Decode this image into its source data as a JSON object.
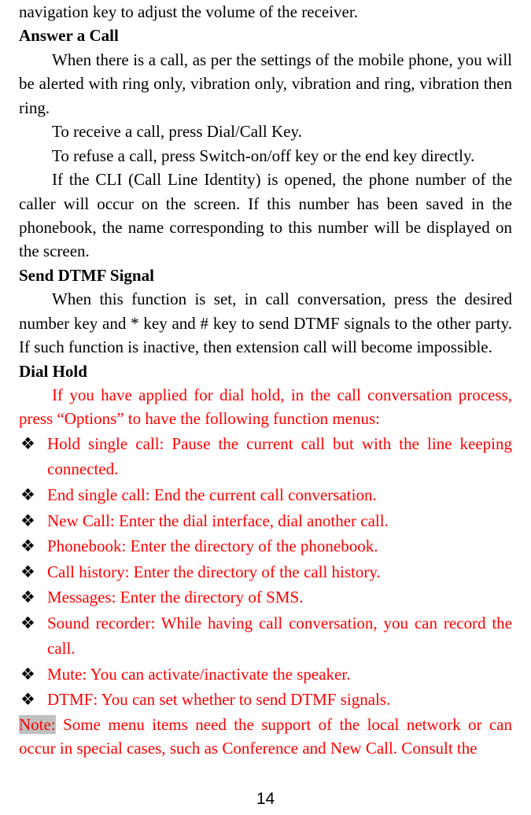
{
  "partial_top": "navigation key to adjust the volume of the receiver.",
  "h_answer": "Answer a Call",
  "answer_p1": "When there is a call, as per the settings of the mobile phone, you will be alerted with ring only, vibration only, vibration and ring, vibration then ring.",
  "answer_p2": "To receive a call, press Dial/Call Key.",
  "answer_p3": "To refuse a call, press Switch-on/off key or the end key directly.",
  "answer_p4": "If the CLI (Call Line Identity) is opened, the phone number of the caller will occur on the screen. If this number has been saved in the phonebook, the name corresponding to this number will be displayed on the screen.",
  "h_dtmf": "Send DTMF Signal",
  "dtmf_p1": "When this function is set, in call conversation, press the desired number key and * key and # key to send DTMF signals to the other party. If such function is inactive, then extension call will become impossible.",
  "h_dialhold": "Dial Hold",
  "dialhold_intro": "If you have applied for dial hold, in the call conversation process, press “Options” to have the following function menus:",
  "bullet": "❖",
  "items": [
    "Hold single call: Pause the current call but with the line keeping connected.",
    "End single call: End the current call conversation.",
    "New Call: Enter the dial interface, dial another call.",
    "Phonebook: Enter the directory of the phonebook.",
    "Call history: Enter the directory of the call history.",
    "Messages: Enter the directory of SMS.",
    "Sound recorder: While having call conversation, you can record the call.",
    "Mute: You can activate/inactivate the speaker.",
    "DTMF: You can set whether to send DTMF signals."
  ],
  "note_label": "Note:",
  "note_text": " Some menu items need the support of the local network or can occur in special cases, such as Conference and New Call. Consult the",
  "page_number": "14"
}
